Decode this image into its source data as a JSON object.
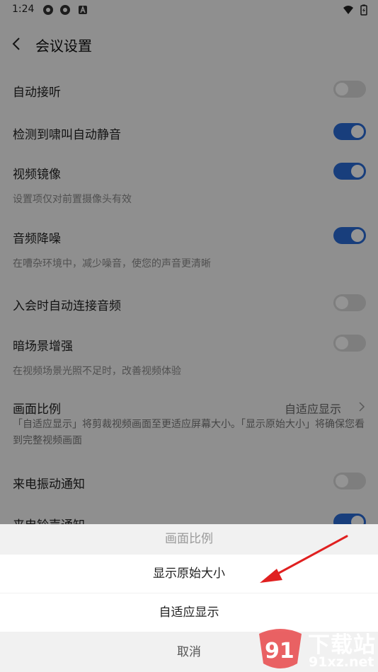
{
  "status_bar": {
    "time": "1:24"
  },
  "header": {
    "title": "会议设置"
  },
  "settings": [
    {
      "label": "自动接听",
      "toggle": false
    },
    {
      "label": "检测到啸叫自动静音",
      "toggle": true
    },
    {
      "label": "视频镜像",
      "toggle": true,
      "desc": "设置项仅对前置摄像头有效"
    },
    {
      "label": "音频降噪",
      "toggle": true,
      "desc": "在嘈杂环境中，减少噪音，使您的声音更清晰"
    },
    {
      "label": "入会时自动连接音频",
      "toggle": false
    },
    {
      "label": "暗场景增强",
      "toggle": false,
      "desc": "在视频场景光照不足时，改善视频体验"
    },
    {
      "label": "来电振动通知",
      "toggle": false
    },
    {
      "label": "来电铃声通知",
      "toggle": true
    }
  ],
  "aspect": {
    "label": "画面比例",
    "value": "自适应显示",
    "desc": "「自适应显示」将剪裁视频画面至更适应屏幕大小。「显示原始大小」将确保您看到完整视频画面"
  },
  "sheet": {
    "title": "画面比例",
    "option_original": "显示原始大小",
    "option_adaptive": "自适应显示",
    "cancel": "取消"
  },
  "watermark": {
    "big": "下载站",
    "small": "91xz.net"
  },
  "colors": {
    "accent": "#2a6bd6",
    "annotation_arrow": "#e02020",
    "watermark": "#e8484a"
  }
}
